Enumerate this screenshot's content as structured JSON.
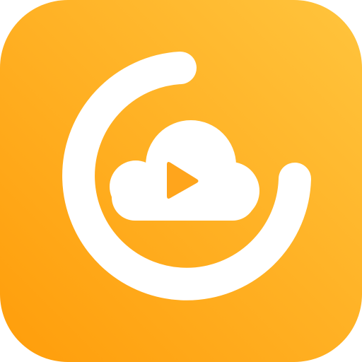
{
  "app_icon": {
    "name": "cloud-video-player-app-icon",
    "icons": {
      "ring": "circular-progress-ring-icon",
      "cloud": "cloud-icon",
      "play": "play-icon"
    },
    "colors": {
      "tile_gradient_top_right": "#FFC43D",
      "tile_gradient_bottom_left": "#FF9D0A",
      "glyph": "#FFFFFF",
      "play_accent": "#FFA51C"
    }
  }
}
